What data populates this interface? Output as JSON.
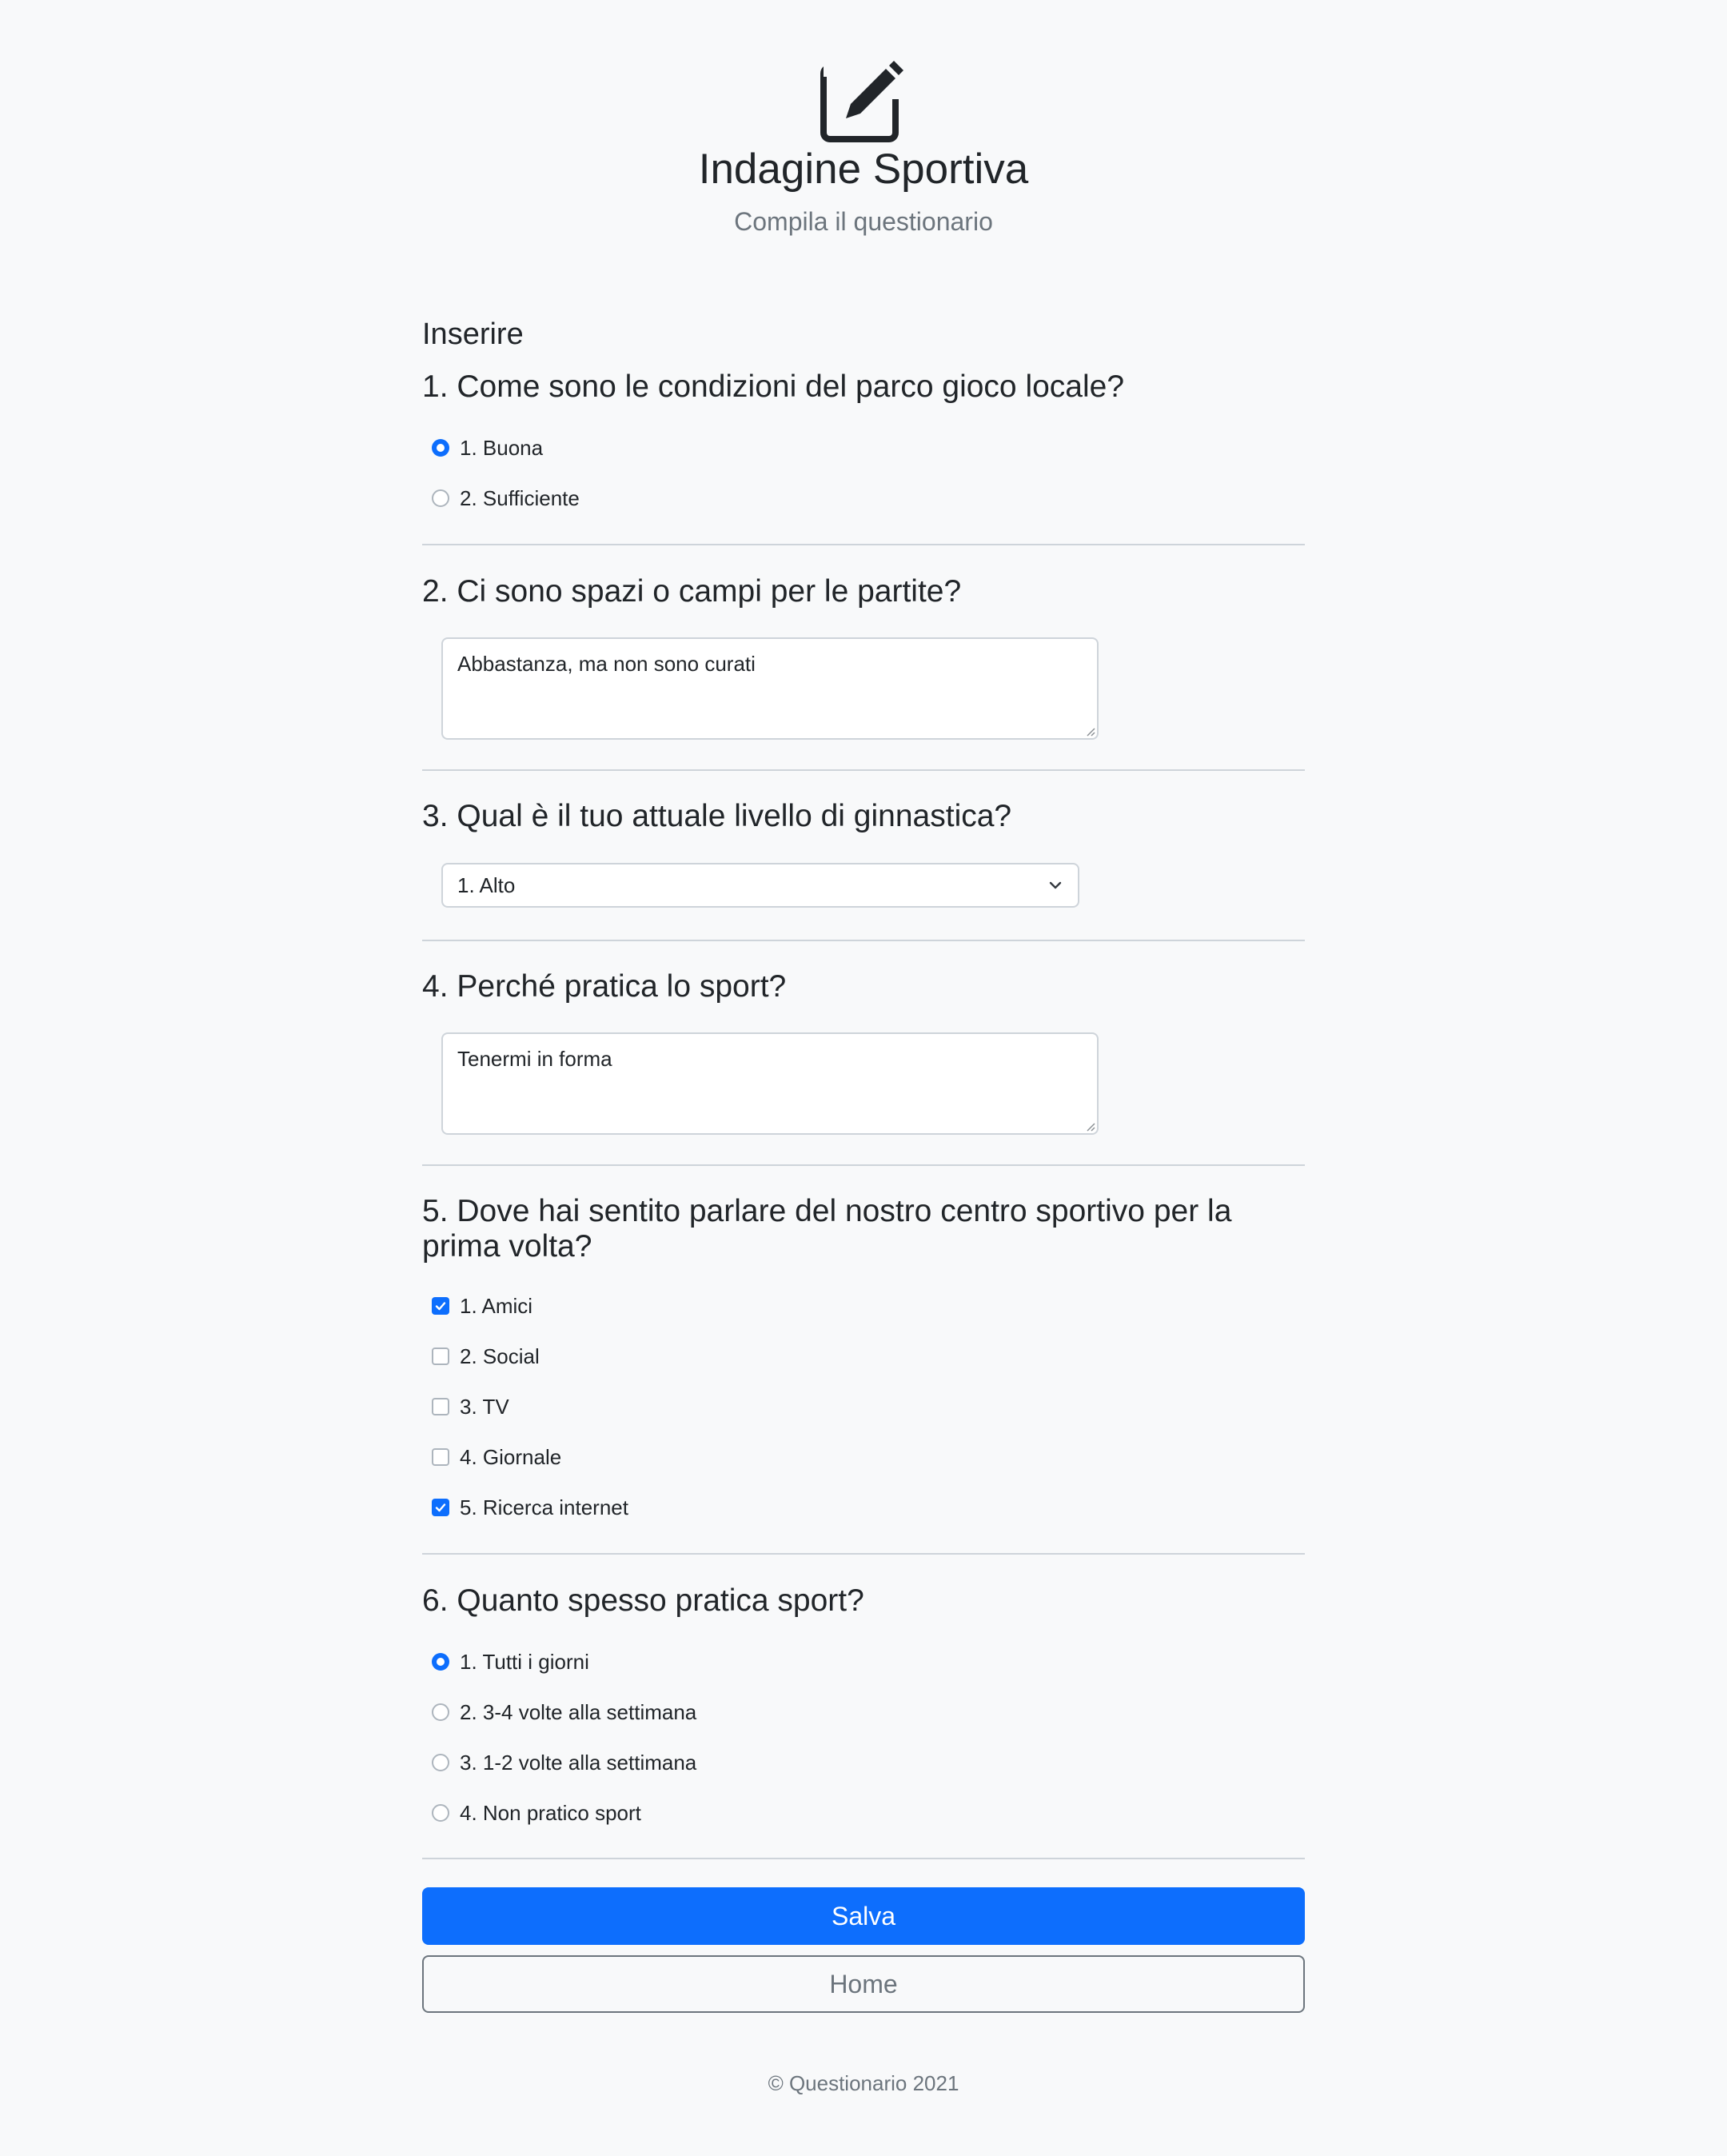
{
  "header": {
    "logo_icon": "pencil-square-icon",
    "title": "Indagine Sportiva",
    "subtitle": "Compila il questionario"
  },
  "form": {
    "section_title": "Inserire",
    "q1": {
      "question": "1. Come sono le condizioni del parco gioco locale?",
      "options": [
        {
          "label": "1. Buona",
          "selected": true
        },
        {
          "label": "2. Sufficiente",
          "selected": false
        }
      ]
    },
    "q2": {
      "question": "2. Ci sono spazi o campi per le partite?",
      "answer": "Abbastanza, ma non sono curati"
    },
    "q3": {
      "question": "3. Qual è il tuo attuale livello di ginnastica?",
      "selected": "1. Alto"
    },
    "q4": {
      "question": "4. Perché pratica lo sport?",
      "answer": "Tenermi in forma"
    },
    "q5": {
      "question": "5. Dove hai sentito parlare del nostro centro sportivo per la prima volta?",
      "options": [
        {
          "label": "1. Amici",
          "checked": true
        },
        {
          "label": "2. Social",
          "checked": false
        },
        {
          "label": "3. TV",
          "checked": false
        },
        {
          "label": "4. Giornale",
          "checked": false
        },
        {
          "label": "5. Ricerca internet",
          "checked": true
        }
      ]
    },
    "q6": {
      "question": "6. Quanto spesso pratica sport?",
      "options": [
        {
          "label": "1. Tutti i giorni",
          "selected": true
        },
        {
          "label": "2. 3-4 volte alla settimana",
          "selected": false
        },
        {
          "label": "3. 1-2 volte alla settimana",
          "selected": false
        },
        {
          "label": "4. Non pratico sport",
          "selected": false
        }
      ]
    }
  },
  "buttons": {
    "save_label": "Salva",
    "home_label": "Home"
  },
  "footer": {
    "text": "© Questionario 2021"
  },
  "colors": {
    "primary": "#0d6efd",
    "background": "#f8f9fa",
    "muted": "#6c757d"
  }
}
